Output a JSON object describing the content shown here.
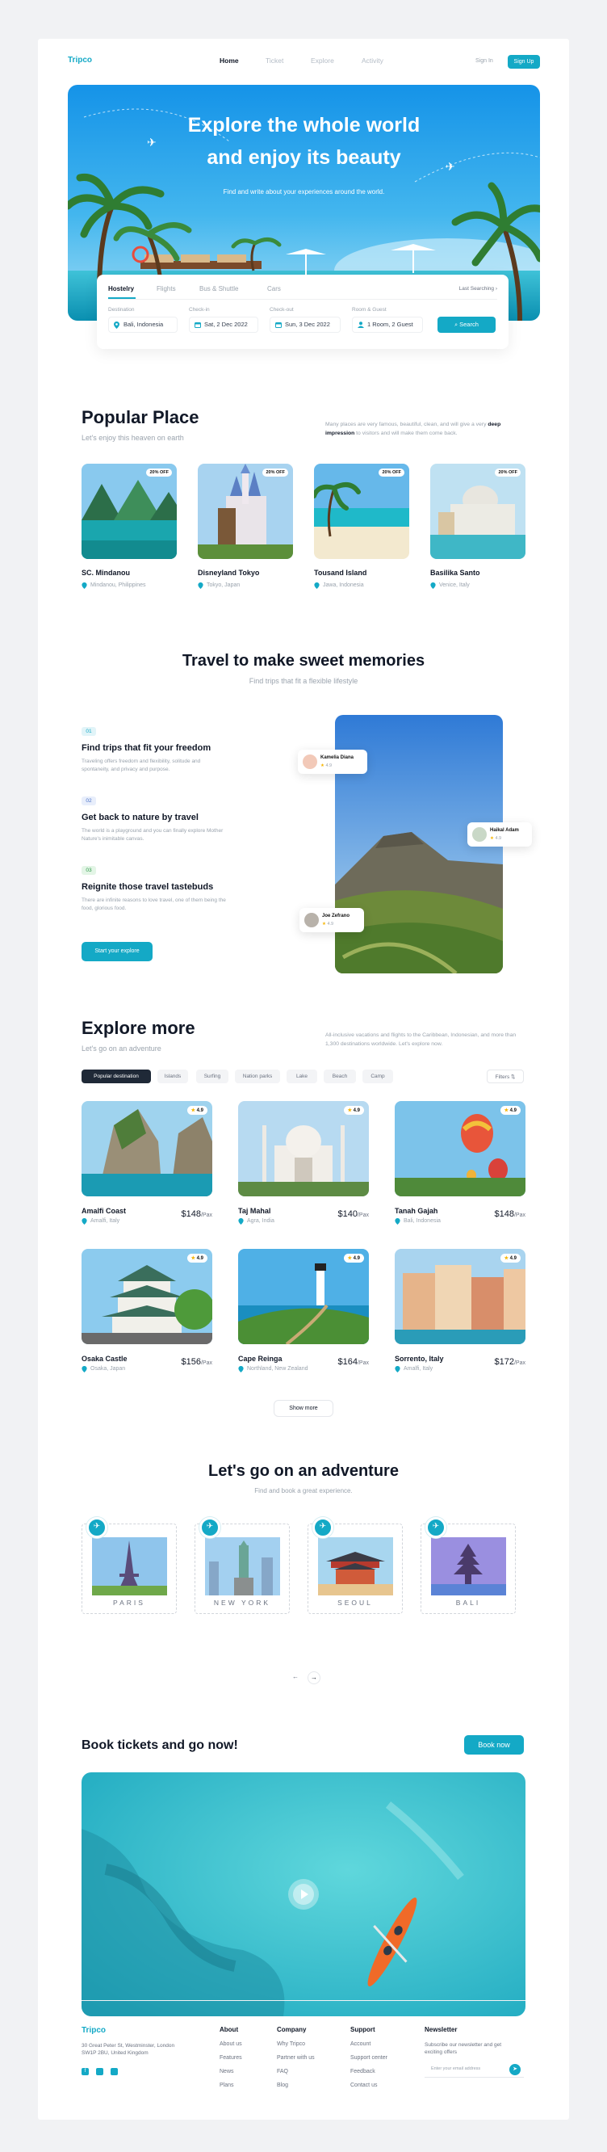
{
  "brand": "Tripco",
  "nav": {
    "home": "Home",
    "ticket": "Ticket",
    "explore": "Explore",
    "activity": "Activity",
    "signin": "Sign In",
    "signup": "Sign Up"
  },
  "hero": {
    "title_line1": "Explore the whole world",
    "title_line2": "and enjoy its beauty",
    "subtitle": "Find and write about your experiences around the world."
  },
  "search": {
    "tabs": [
      "Hostelry",
      "Flights",
      "Bus & Shuttle",
      "Cars"
    ],
    "last_searching": "Last Searching",
    "fields": [
      {
        "label": "Destination",
        "value": "Bali, Indonesia",
        "icon": "pin-icon"
      },
      {
        "label": "Check-in",
        "value": "Sat, 2 Dec 2022",
        "icon": "calendar-icon"
      },
      {
        "label": "Check-out",
        "value": "Sun, 3 Dec 2022",
        "icon": "calendar-icon"
      },
      {
        "label": "Room & Guest",
        "value": "1 Room, 2 Guest",
        "icon": "user-icon"
      }
    ],
    "button": "Search"
  },
  "popular": {
    "title": "Popular Place",
    "subtitle": "Let's enjoy this heaven on earth",
    "desc_normal": "Many places are very famous, beautiful, clean, and will give a very",
    "desc_bold": "deep impression",
    "desc_tail": "to visitors and will make them come back.",
    "places": [
      {
        "name": "SC. Mindanou",
        "location": "Mindanou, Philippines",
        "badge": "20% OFF"
      },
      {
        "name": "Disneyland Tokyo",
        "location": "Tokyo, Japan",
        "badge": "20% OFF"
      },
      {
        "name": "Tousand Island",
        "location": "Jawa, Indonesia",
        "badge": "20% OFF"
      },
      {
        "name": "Basilika Santo",
        "location": "Venice, Italy",
        "badge": "20% OFF"
      }
    ]
  },
  "travel": {
    "title": "Travel to make sweet memories",
    "subtitle": "Find trips that fit a flexible lifestyle",
    "features": [
      {
        "num": "01",
        "title": "Find trips that fit your freedom",
        "desc": "Traveling offers freedom and flexibility, solitude and spontaneity, and privacy and purpose."
      },
      {
        "num": "02",
        "title": "Get back to nature by travel",
        "desc": "The world is a playground and you can finally explore Mother Nature's inimitable canvas."
      },
      {
        "num": "03",
        "title": "Reignite those travel tastebuds",
        "desc": "There are infinite reasons to love travel, one of them being the food, glorious food."
      }
    ],
    "button": "Start your explore",
    "reviewers": [
      {
        "name": "Kamelia Diana",
        "rating": "4.9"
      },
      {
        "name": "Haikal Adam",
        "rating": "4.9"
      },
      {
        "name": "Joe Zefrano",
        "rating": "4.9"
      }
    ]
  },
  "explore": {
    "title": "Explore more",
    "subtitle": "Let's go on an adventure",
    "desc": "All-inclusive vacations and flights to the Caribbean, Indonesian, and more than 1,300 destinations worldwide. Let's explore now.",
    "chips": [
      "Popular destination",
      "Islands",
      "Surfing",
      "Nation parks",
      "Lake",
      "Beach",
      "Camp"
    ],
    "filters": "Filters",
    "items": [
      {
        "name": "Amalfi Coast",
        "location": "Amalfi, Italy",
        "price": "$148",
        "unit": "/Pax",
        "rating": "4.9"
      },
      {
        "name": "Taj Mahal",
        "location": "Agra, India",
        "price": "$140",
        "unit": "/Pax",
        "rating": "4.9"
      },
      {
        "name": "Tanah Gajah",
        "location": "Bali, Indonesia",
        "price": "$148",
        "unit": "/Pax",
        "rating": "4.9"
      },
      {
        "name": "Osaka Castle",
        "location": "Osaka, Japan",
        "price": "$156",
        "unit": "/Pax",
        "rating": "4.9"
      },
      {
        "name": "Cape Reinga",
        "location": "Northland, New Zealand",
        "price": "$164",
        "unit": "/Pax",
        "rating": "4.9"
      },
      {
        "name": "Sorrento, Italy",
        "location": "Amalfi, Italy",
        "price": "$172",
        "unit": "/Pax",
        "rating": "4.9"
      }
    ],
    "show_more": "Show more"
  },
  "adventure": {
    "title": "Let's go on an adventure",
    "subtitle": "Find and book a great experience.",
    "stamps": [
      "PARIS",
      "NEW YORK",
      "SEOUL",
      "BALI"
    ],
    "prev": "←",
    "next": "→"
  },
  "book": {
    "title": "Book tickets and go now!",
    "button": "Book now"
  },
  "footer": {
    "brand": "Tripco",
    "address": "30 Great Peter St, Westminster, London SW1P 2BU, United Kingdom",
    "columns": [
      {
        "title": "About",
        "links": [
          "About us",
          "Features",
          "News",
          "Plans"
        ]
      },
      {
        "title": "Company",
        "links": [
          "Why Tripco",
          "Partner with us",
          "FAQ",
          "Blog"
        ]
      },
      {
        "title": "Support",
        "links": [
          "Account",
          "Support center",
          "Feedback",
          "Contact us"
        ]
      }
    ],
    "newsletter_title": "Newsletter",
    "newsletter_desc": "Subscribe our newsletter and get exciting offers",
    "email_placeholder": "Enter your email address"
  },
  "colors": {
    "accent": "#14a9c6",
    "text": "#111827",
    "muted": "#9aa3ad"
  }
}
